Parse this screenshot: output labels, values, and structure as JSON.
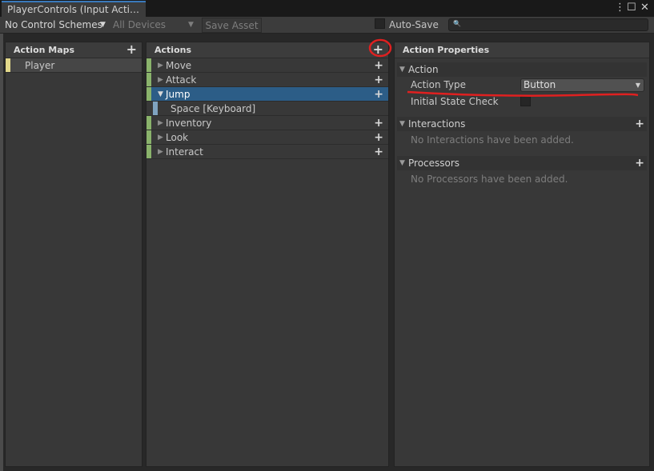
{
  "window": {
    "tab_title": "PlayerControls (Input Acti…",
    "menu_icon": "⋮",
    "maximize_icon": "☐",
    "close_icon": "✕"
  },
  "toolbar": {
    "control_schemes": "No Control Schemes",
    "devices": "All Devices",
    "save_asset": "Save Asset",
    "auto_save": "Auto-Save",
    "search_icon": "🔍",
    "search_value": ""
  },
  "action_maps": {
    "header": "Action Maps",
    "items": [
      {
        "label": "Player",
        "selected": true
      }
    ]
  },
  "actions": {
    "header": "Actions",
    "items": [
      {
        "label": "Move",
        "expanded": false,
        "selected": false
      },
      {
        "label": "Attack",
        "expanded": false,
        "selected": false
      },
      {
        "label": "Jump",
        "expanded": true,
        "selected": true
      },
      {
        "label": "Space [Keyboard]",
        "binding": true
      },
      {
        "label": "Inventory",
        "expanded": false,
        "selected": false
      },
      {
        "label": "Look",
        "expanded": false,
        "selected": false
      },
      {
        "label": "Interact",
        "expanded": false,
        "selected": false
      }
    ]
  },
  "properties": {
    "header": "Action Properties",
    "action_section": "Action",
    "action_type_label": "Action Type",
    "action_type_value": "Button",
    "initial_state_label": "Initial State Check",
    "interactions_section": "Interactions",
    "interactions_empty": "No Interactions have been added.",
    "processors_section": "Processors",
    "processors_empty": "No Processors have been added."
  },
  "colors": {
    "accent": "#2c5d87",
    "action_bar": "#8ab36b",
    "map_bar": "#e3d98b",
    "binding_bar": "#7fa3c0",
    "annotation": "#e02020"
  }
}
